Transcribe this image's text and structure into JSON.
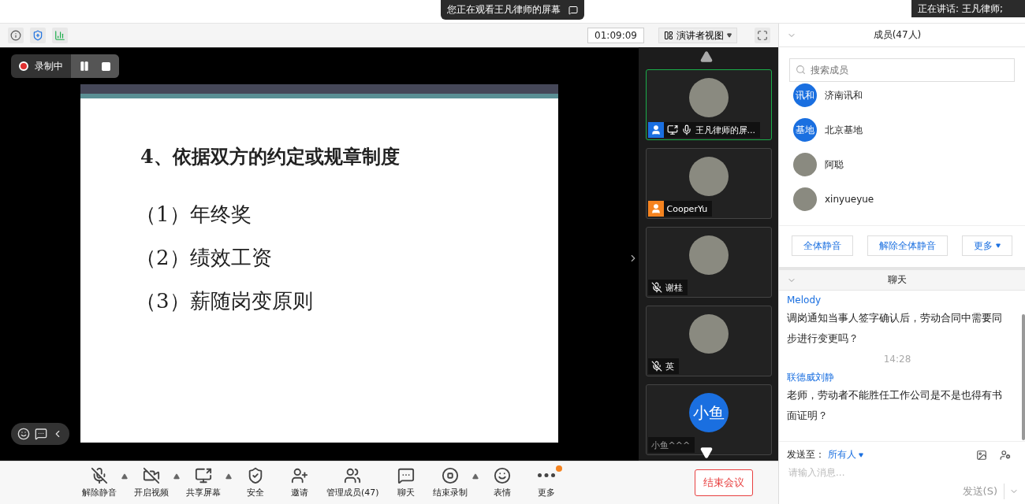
{
  "top_banner": {
    "text": "您正在观看王凡律师的屏幕"
  },
  "speaker": {
    "text": "正在讲话: 王凡律师;"
  },
  "toolbar": {
    "timer": "01:09:09",
    "view": "演讲者视图"
  },
  "recording": {
    "label": "录制中"
  },
  "slide": {
    "title": "4、依据双方的约定或规章制度",
    "items": [
      "（1）年终奖",
      "（2）绩效工资",
      "（3）薪随岗变原则"
    ]
  },
  "videos": [
    {
      "name": "王凡律师的屏...",
      "kind": "host",
      "selected": true
    },
    {
      "name": "CooperYu",
      "kind": "member",
      "selected": false
    },
    {
      "name": "谢桂",
      "kind": "muted",
      "selected": false
    },
    {
      "name": "英",
      "kind": "muted",
      "selected": false
    },
    {
      "name": "小鱼^^^",
      "kind": "plain",
      "selected": false,
      "avatar_text": "小鱼"
    }
  ],
  "members": {
    "title": "成员(47人)",
    "search_placeholder": "搜索成员",
    "list": [
      {
        "name": "济南讯和",
        "avatar_text": "讯和"
      },
      {
        "name": "北京基地",
        "avatar_text": "基地"
      },
      {
        "name": "阿聪"
      },
      {
        "name": "xinyueyue"
      }
    ],
    "actions": [
      {
        "label": "全体静音",
        "caret": false
      },
      {
        "label": "解除全体静音",
        "caret": false
      },
      {
        "label": "更多",
        "caret": true
      }
    ]
  },
  "chat": {
    "title": "聊天",
    "messages": [
      {
        "kind": "sender",
        "text": "Melody"
      },
      {
        "kind": "text",
        "text": "调岗通知当事人签字确认后，劳动合同中需要同步进行变更吗？"
      },
      {
        "kind": "time",
        "text": "14:28"
      },
      {
        "kind": "sender",
        "text": "联德威刘静"
      },
      {
        "kind": "text",
        "text": "老师，劳动者不能胜任工作公司是不是也得有书面证明？"
      }
    ],
    "send_to_label": "发送至：",
    "send_to": "所有人",
    "placeholder": "请输入消息...",
    "send": "发送(S)"
  },
  "bottom_bar": {
    "items": [
      {
        "label": "解除静音",
        "kind": "mic",
        "caret": true,
        "badge": false
      },
      {
        "label": "开启视频",
        "kind": "video",
        "caret": true,
        "badge": false
      },
      {
        "label": "共享屏幕",
        "kind": "share",
        "caret": true,
        "badge": false
      },
      {
        "label": "安全",
        "kind": "security",
        "caret": false,
        "badge": false
      },
      {
        "label": "邀请",
        "kind": "invite",
        "caret": false,
        "badge": false
      },
      {
        "label": "管理成员(47)",
        "kind": "members",
        "caret": false,
        "badge": false
      },
      {
        "label": "聊天",
        "kind": "chat",
        "caret": false,
        "badge": false
      },
      {
        "label": "结束录制",
        "kind": "record",
        "caret": true,
        "badge": false
      },
      {
        "label": "表情",
        "kind": "emoji",
        "caret": false,
        "badge": false
      },
      {
        "label": "更多",
        "kind": "more",
        "caret": false,
        "badge": true
      }
    ],
    "end": "结束会议"
  }
}
